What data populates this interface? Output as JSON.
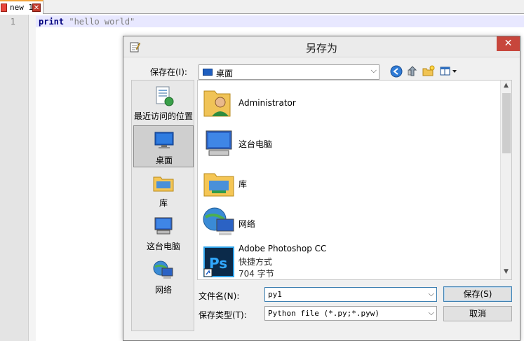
{
  "editor": {
    "tab_label": "new 1",
    "tab_close": "✕",
    "line_number": "1",
    "code_keyword": "print",
    "code_string": "\"hello world\""
  },
  "dialog": {
    "title": "另存为",
    "close": "✕",
    "save_in_label": "保存在(I):",
    "save_in_value": "桌面",
    "places": [
      {
        "label": "最近访问的位置",
        "icon": "recent-places-icon"
      },
      {
        "label": "桌面",
        "icon": "desktop-icon"
      },
      {
        "label": "库",
        "icon": "libraries-icon"
      },
      {
        "label": "这台电脑",
        "icon": "this-pc-icon"
      },
      {
        "label": "网络",
        "icon": "network-icon"
      }
    ],
    "files": [
      {
        "name": "Administrator",
        "icon": "user-folder-icon"
      },
      {
        "name": "这台电脑",
        "icon": "this-pc-icon"
      },
      {
        "name": "库",
        "icon": "libraries-icon"
      },
      {
        "name": "网络",
        "icon": "network-icon"
      },
      {
        "name": "Adobe Photoshop CC",
        "type": "快捷方式",
        "size": "704 字节",
        "icon": "photoshop-shortcut-icon"
      }
    ],
    "file_name_label": "文件名(N):",
    "file_name_value": "py1",
    "save_type_label": "保存类型(T):",
    "save_type_value": "Python file (*.py;*.pyw)",
    "save_button": "保存(S)",
    "cancel_button": "取消"
  },
  "colors": {
    "close_red": "#c7463c",
    "accent_blue": "#3c7fb1",
    "keyword_blue": "#000080"
  }
}
